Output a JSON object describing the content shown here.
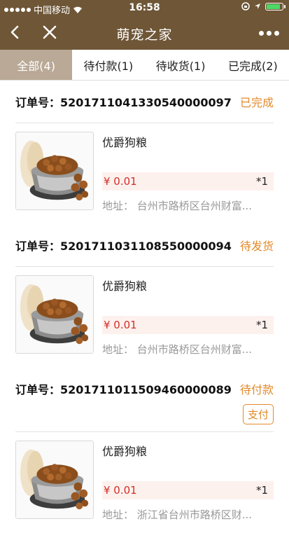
{
  "status_bar": {
    "carrier": "中国移动",
    "time": "16:58"
  },
  "nav": {
    "title": "萌宠之家"
  },
  "tabs": [
    {
      "label": "全部(4)",
      "active": true
    },
    {
      "label": "待付款(1)",
      "active": false
    },
    {
      "label": "待收货(1)",
      "active": false
    },
    {
      "label": "已完成(2)",
      "active": false
    }
  ],
  "orders": [
    {
      "order_label": "订单号：5201711041330540000097",
      "status": "已完成",
      "item": {
        "name": "优爵狗粮",
        "price": "¥ 0.01",
        "qty": "*1",
        "address": "地址：  台州市路桥区台州财富..."
      }
    },
    {
      "order_label": "订单号：5201711031108550000094",
      "status": "待发货",
      "item": {
        "name": "优爵狗粮",
        "price": "¥ 0.01",
        "qty": "*1",
        "address": "地址：  台州市路桥区台州财富..."
      }
    },
    {
      "order_label": "订单号：5201711011509460000089",
      "status": "待付款",
      "action": "支付",
      "item": {
        "name": "优爵狗粮",
        "price": "¥ 0.01",
        "qty": "*1",
        "address": "地址：  浙江省台州市路桥区财..."
      }
    }
  ],
  "colors": {
    "header_bg": "#6e5637",
    "active_tab_bg": "#b9a996",
    "status_orange": "#e28a2a",
    "price_red": "#d0302a"
  },
  "icons": [
    "back-icon",
    "close-icon",
    "more-icon",
    "wifi-icon",
    "location-icon",
    "battery-icon"
  ]
}
